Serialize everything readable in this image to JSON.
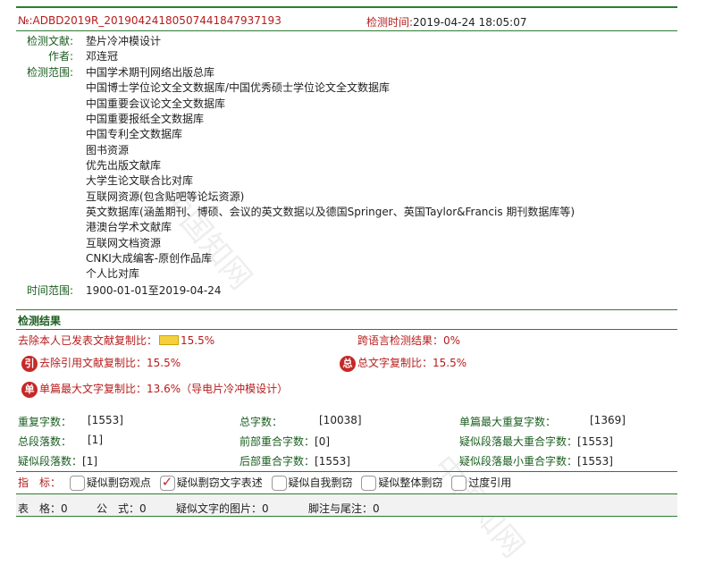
{
  "header": {
    "report_no": "№:ADBD2019R_20190424180507441847937193",
    "time_label": "检测时间:",
    "time_value": "2019-04-24 18:05:07"
  },
  "doc": {
    "title_label": "检测文献:",
    "title_value": "垫片冷冲模设计",
    "author_label": "作者:",
    "author_value": "邓连冠",
    "scope_label": "检测范围:",
    "scope_items": [
      "中国学术期刊网络出版总库",
      "中国博士学位论文全文数据库/中国优秀硕士学位论文全文数据库",
      "中国重要会议论文全文数据库",
      "中国重要报纸全文数据库",
      "中国专利全文数据库",
      "图书资源",
      "优先出版文献库",
      "大学生论文联合比对库",
      "互联网资源(包含贴吧等论坛资源)",
      "英文数据库(涵盖期刊、博硕、会议的英文数据以及德国Springer、英国Taylor&Francis 期刊数据库等)",
      "港澳台学术文献库",
      "互联网文档资源",
      "CNKI大成编客-原创作品库",
      "个人比对库"
    ],
    "range_label": "时间范围:",
    "range_value": "1900-01-01至2019-04-24"
  },
  "results": {
    "section_title": "检测结果",
    "excl_self_label": "去除本人已发表文献复制比：",
    "excl_self_value": "15.5%",
    "cross_lang_label": "跨语言检测结果：",
    "cross_lang_value": "0%",
    "excl_quote_icon": "引",
    "excl_quote_label": "去除引用文献复制比：",
    "excl_quote_value": "15.5%",
    "total_icon": "总",
    "total_label": "总文字复制比：",
    "total_value": "15.5%",
    "single_icon": "单",
    "single_label": "单篇最大文字复制比：",
    "single_value": "13.6%",
    "single_note": "（导电片冷冲模设计）"
  },
  "stats": {
    "dup_chars_label": "重复字数：",
    "dup_chars_value": "[1553]",
    "total_chars_label": "总字数：",
    "total_chars_value": "[10038]",
    "max_dup_label": "单篇最大重复字数：",
    "max_dup_value": "[1369]",
    "para_count_label": "总段落数：",
    "para_count_value": "[1]",
    "front_label": "前部重合字数：",
    "front_value": "[0]",
    "max_para_label": "疑似段落最大重合字数：",
    "max_para_value": "[1553]",
    "susp_para_label": "疑似段落数：",
    "susp_para_value": "[1]",
    "back_label": "后部重合字数：",
    "back_value": "[1553]",
    "min_para_label": "疑似段落最小重合字数：",
    "min_para_value": "[1553]"
  },
  "indicators": {
    "label": "指　标：",
    "items": [
      {
        "label": "疑似剽窃观点",
        "checked": false
      },
      {
        "label": "疑似剽窃文字表述",
        "checked": true
      },
      {
        "label": "疑似自我剽窃",
        "checked": false
      },
      {
        "label": "疑似整体剽窃",
        "checked": false
      },
      {
        "label": "过度引用",
        "checked": false
      }
    ]
  },
  "footer": {
    "tables": "表　格：0",
    "formulas": "公　式：0",
    "images": "疑似文字的图片：0",
    "notes": "脚注与尾注：0"
  },
  "colors": {
    "accent_green": "#2e7d32",
    "label_green": "#1b5e20",
    "header_red": "#b71c1c",
    "badge_red": "#c62828"
  }
}
